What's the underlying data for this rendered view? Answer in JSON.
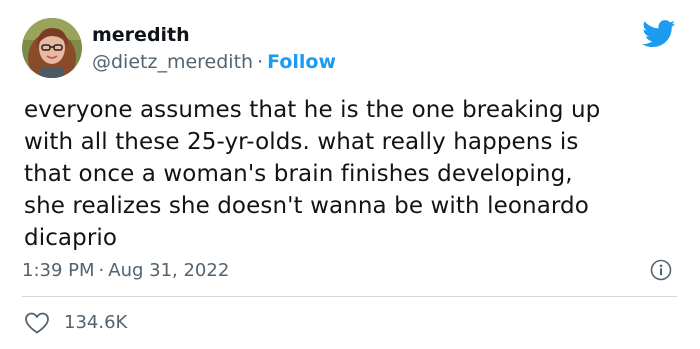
{
  "author": {
    "display_name": "meredith",
    "handle": "@dietz_meredith",
    "separator": "·",
    "follow_label": "Follow"
  },
  "logo_icon": "twitter-bird-icon",
  "tweet": {
    "text": "everyone assumes that he is the one breaking up\nwith all these 25-yr-olds. what really happens is\nthat once a woman's brain finishes developing,\nshe realizes she doesn't wanna be with leonardo\ndicaprio"
  },
  "meta": {
    "time": "1:39 PM",
    "separator": "·",
    "date": "Aug 31, 2022",
    "info_icon": "info-icon"
  },
  "engagement": {
    "like_icon": "heart-icon",
    "like_count": "134.6K"
  },
  "colors": {
    "accent": "#1d9bf0",
    "text": "#0f1419",
    "secondary": "#536471",
    "divider": "#cfd9de"
  }
}
